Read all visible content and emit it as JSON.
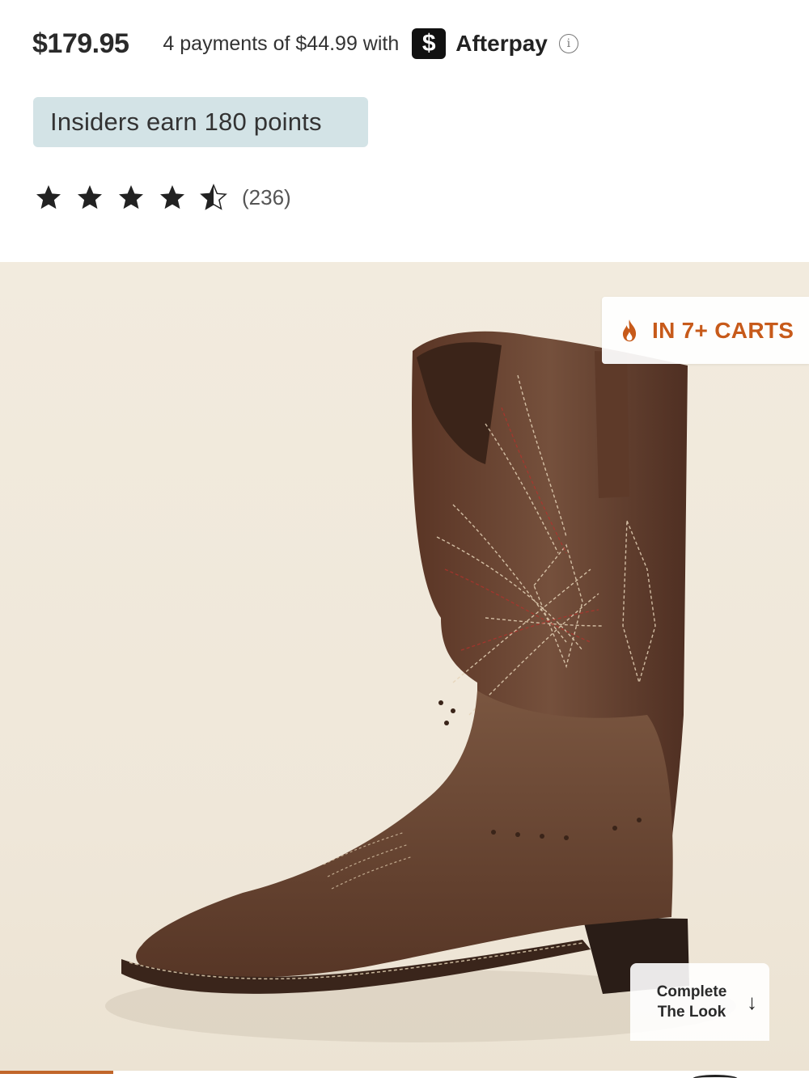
{
  "price": {
    "amount": "$179.95",
    "installments_text": "4 payments of $44.99 with",
    "afterpay_logo_glyph": "$",
    "afterpay_label": "Afterpay",
    "info_glyph": "i"
  },
  "insiders": {
    "text": "Insiders earn 180 points"
  },
  "rating": {
    "value": 4.5,
    "max": 5,
    "count_text": "(236)"
  },
  "hero": {
    "carts_badge": "IN 7+ CARTS",
    "complete_look": "Complete The Look",
    "arrow_glyph": "↓",
    "image_subject": "brown leather western boot"
  },
  "gallery": {
    "progress": 0.14
  },
  "colors": {
    "accent_orange": "#c75a1a",
    "insiders_bg": "#d3e3e6",
    "boot_leather": "#6b4431",
    "progress": "#c1662a"
  }
}
